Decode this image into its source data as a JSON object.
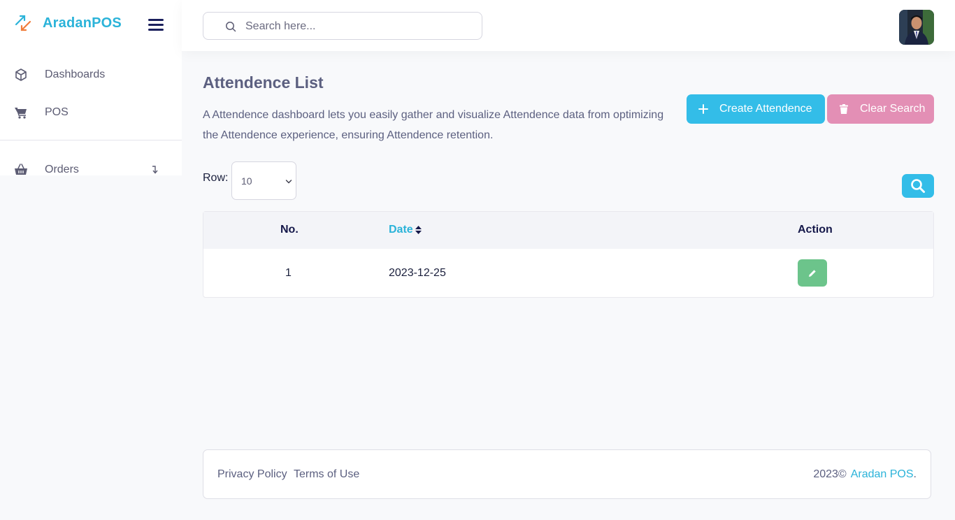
{
  "brand": {
    "name": "AradanPOS"
  },
  "sidebar": {
    "items": [
      {
        "label": "Dashboards",
        "icon": "cube-icon"
      },
      {
        "label": "POS",
        "icon": "cart-icon"
      },
      {
        "label": "Orders",
        "icon": "basket-icon",
        "arrow": "arrow-return-icon"
      }
    ]
  },
  "header": {
    "search_placeholder": "Search here..."
  },
  "page": {
    "title": "Attendence List",
    "description": "A Attendence dashboard lets you easily gather and visualize Attendence data from optimizing the Attendence experience, ensuring Attendence retention.",
    "create_label": "Create Attendence",
    "clear_label": "Clear Search",
    "row_label": "Row:",
    "row_value": "10"
  },
  "table": {
    "columns": [
      "No.",
      "Date",
      "Action"
    ],
    "rows": [
      {
        "no": "1",
        "date": "2023-12-25"
      }
    ]
  },
  "footer": {
    "privacy": "Privacy Policy",
    "terms": "Terms of Use",
    "copyright": "2023©",
    "brand_link": "Aradan POS",
    "period": "."
  },
  "colors": {
    "accent": "#2bb3d9",
    "create_button": "#33bde8",
    "clear_button": "#e38fb5",
    "edit_button": "#6cc48b",
    "heading": "#15184a"
  }
}
